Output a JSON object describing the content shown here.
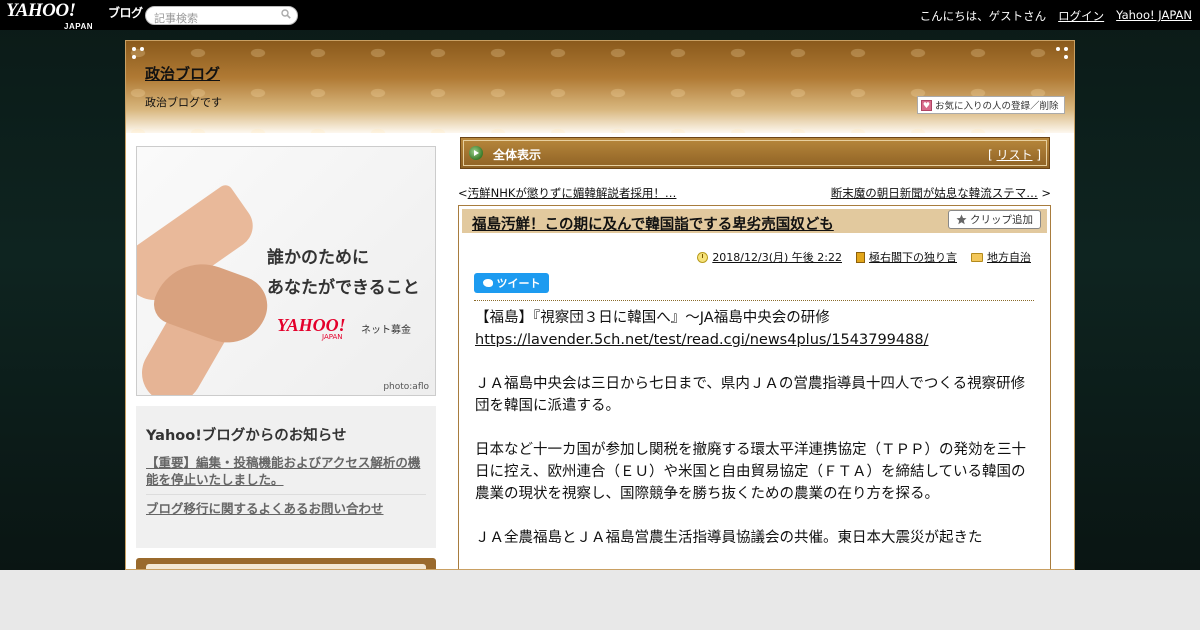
{
  "topbar": {
    "logo_text": "YAHOO!",
    "logo_sub": "JAPAN",
    "logo_blog": "ブログ",
    "search_placeholder": "記事検索",
    "greeting": "こんにちは、ゲストさん",
    "login": "ログイン",
    "yahoo_japan": "Yahoo! JAPAN"
  },
  "header": {
    "blog_title": "政治ブログ",
    "blog_description": "政治ブログです",
    "favorite_button": "お気に入りの人の登録／削除"
  },
  "ad": {
    "line1": "誰かのために",
    "line2": "あなたができること",
    "logo": "YAHOO!",
    "logo_sub": "JAPAN",
    "service": "ネット募金",
    "credit": "photo:aflo"
  },
  "notice": {
    "title": "Yahoo!ブログからのお知らせ",
    "items": [
      "【重要】編集・投稿機能およびアクセス解析の機能を停止いたしました。",
      "ブログ移行に関するよくあるお問い合わせ"
    ]
  },
  "bar": {
    "label": "全体表示",
    "list_prefix": "[",
    "list_label": "リスト",
    "list_suffix": "]"
  },
  "nav": {
    "prev_prefix": "<",
    "prev": "汚鮮NHKが懲りずに媚韓解説者採用！…",
    "next": "断末魔の朝日新聞が姑息な韓流ステマ…",
    "next_suffix": ">"
  },
  "article": {
    "title": "福島汚鮮！この期に及んで韓国詣でする卑劣売国奴ども",
    "clip_button": "クリップ追加",
    "date": "2018/12/3(月) 午後 2:22",
    "category1": "極右閣下の独り言",
    "category2": "地方自治",
    "tweet": "ツイート",
    "para1_line1": "【福島】『視察団３日に韓国へ』～JA福島中央会の研修",
    "para1_link": "https://lavender.5ch.net/test/read.cgi/news4plus/1543799488/",
    "para2": "ＪＡ福島中央会は三日から七日まで、県内ＪＡの営農指導員十四人でつくる視察研修団を韓国に派遣する。",
    "para3": "日本など十一カ国が参加し関税を撤廃する環太平洋連携協定（ＴＰＰ）の発効を三十日に控え、欧州連合（ＥＵ）や米国と自由貿易協定（ＦＴＡ）を締結している韓国の農業の現状を視察し、国際競争を勝ち抜くための農業の在り方を探る。",
    "para4": "ＪＡ全農福島とＪＡ福島営農生活指導員協議会の共催。東日本大震災が起きた"
  }
}
